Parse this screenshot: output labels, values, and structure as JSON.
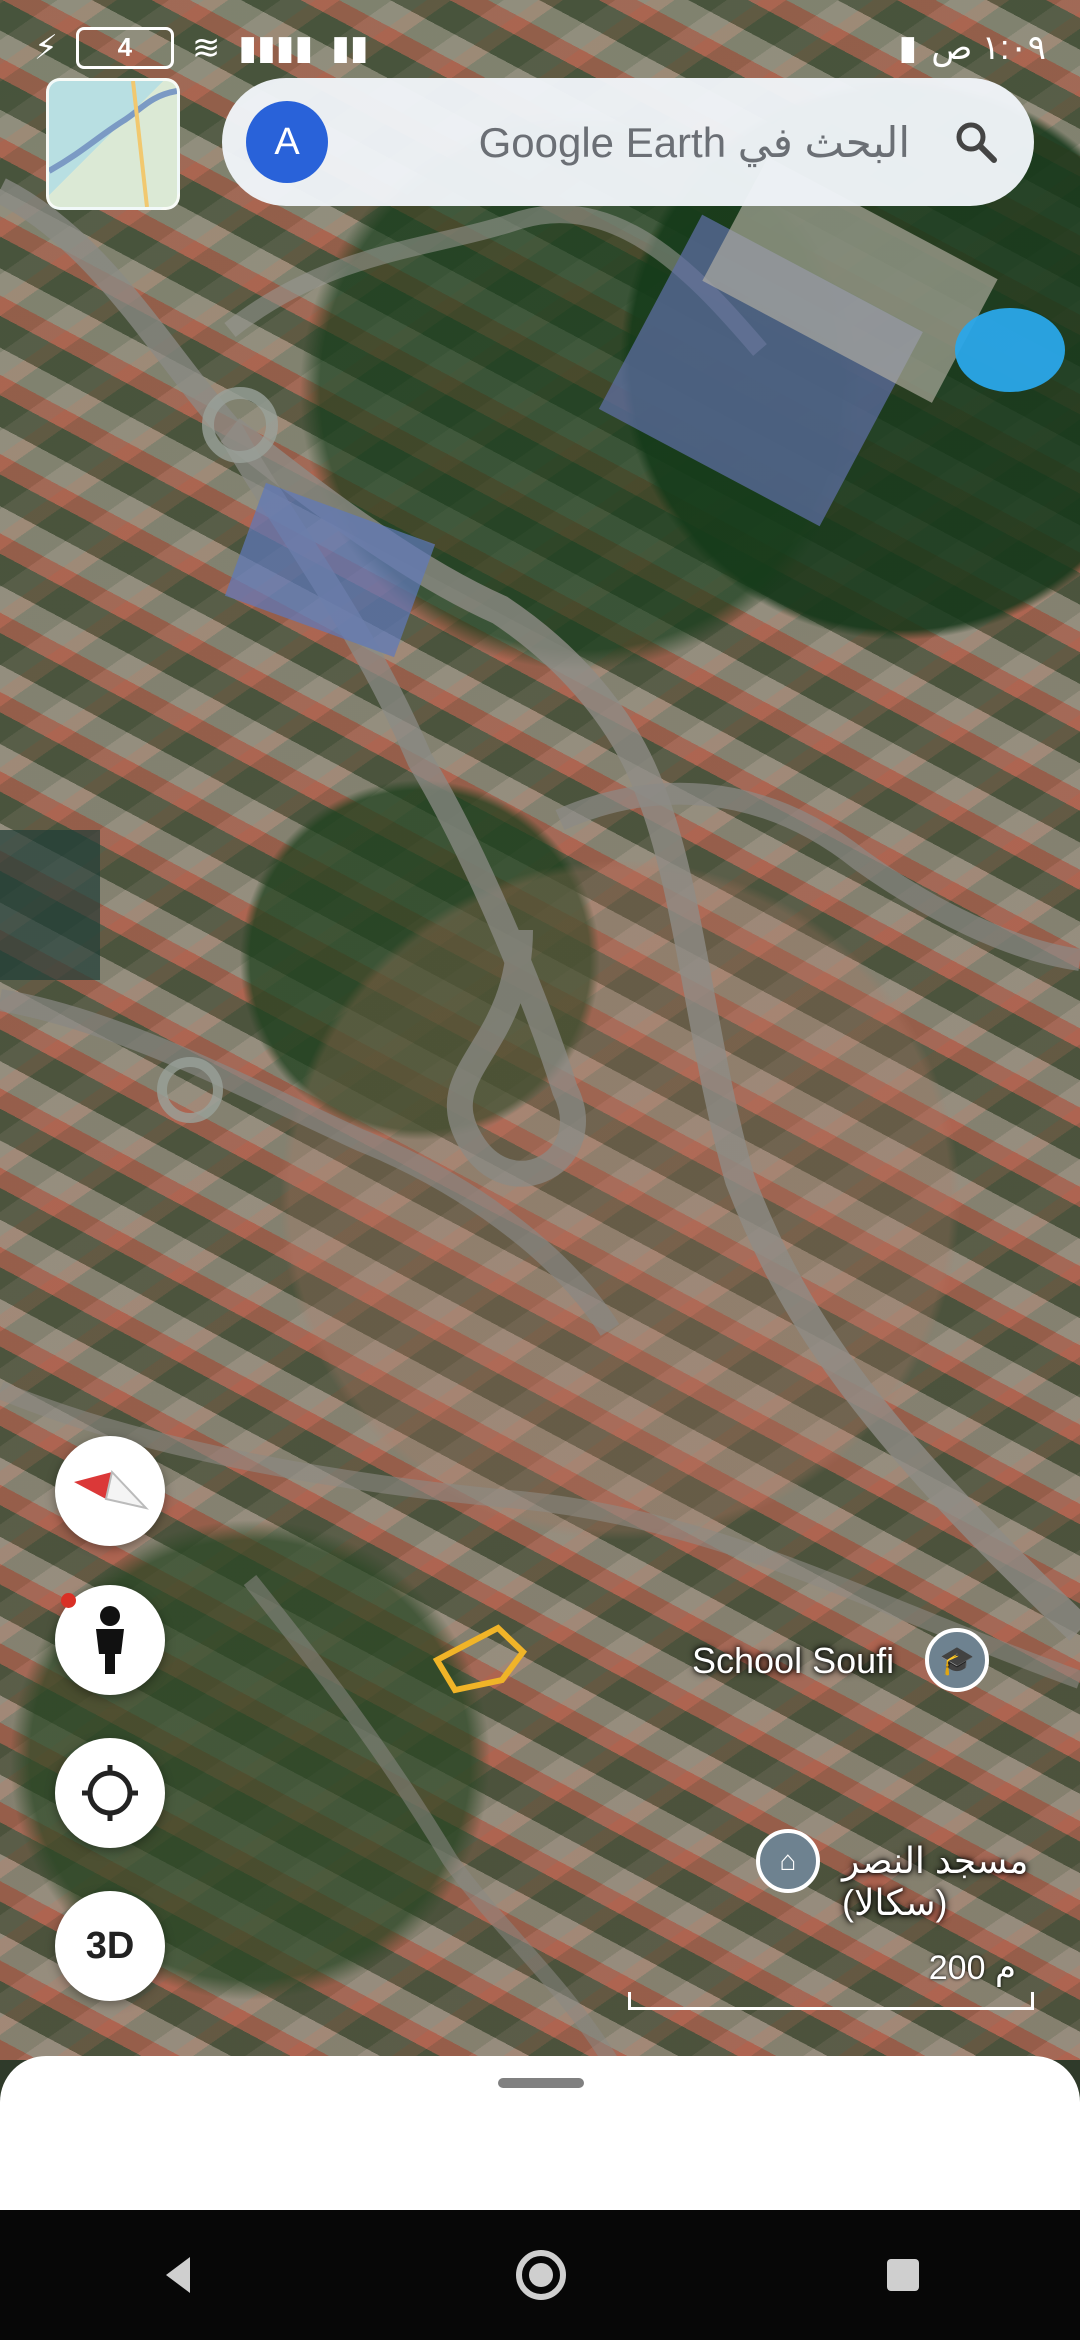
{
  "status_bar": {
    "battery_level": "4",
    "time": "١:٠٩ ص"
  },
  "search": {
    "avatar_letter": "A",
    "placeholder": "البحث في Google Earth"
  },
  "controls": {
    "three_d_label": "3D"
  },
  "places": [
    {
      "name": "School Soufi",
      "icon": "graduation-cap-icon"
    },
    {
      "name": "مسجد النصر (سكالا)",
      "icon": "mosque-icon"
    }
  ],
  "scale": {
    "label": "200 م"
  }
}
